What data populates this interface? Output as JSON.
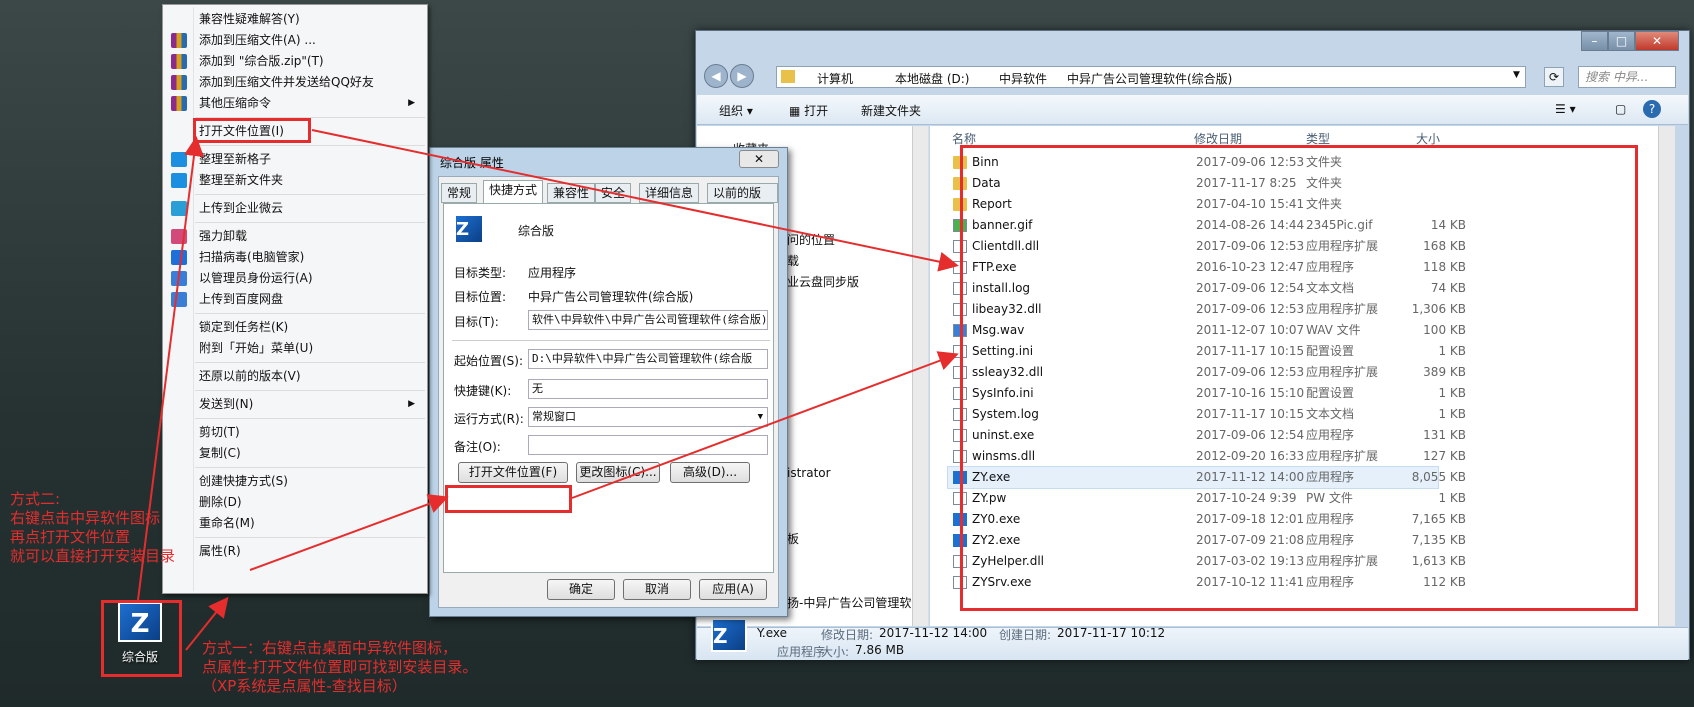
{
  "context_menu": {
    "items": [
      {
        "label": "兼容性疑难解答(Y)",
        "icon": ""
      },
      {
        "label": "添加到压缩文件(A) ...",
        "icon": "winrar-icon"
      },
      {
        "label": "添加到 \"综合版.zip\"(T)",
        "icon": "winrar-icon"
      },
      {
        "label": "添加到压缩文件并发送给QQ好友",
        "icon": "winrar-icon"
      },
      {
        "label": "其他压缩命令",
        "icon": "winrar-icon",
        "submenu": true
      },
      {
        "label": "打开文件位置(I)",
        "icon": ""
      },
      {
        "label": "整理至新格子",
        "icon": "plus-icon"
      },
      {
        "label": "整理至新文件夹",
        "icon": "plus-icon"
      },
      {
        "label": "上传到企业微云",
        "icon": "cloud-icon"
      },
      {
        "label": "强力卸载",
        "icon": "uninstall-icon"
      },
      {
        "label": "扫描病毒(电脑管家)",
        "icon": "shield-icon"
      },
      {
        "label": "以管理员身份运行(A)",
        "icon": "uac-shield-icon"
      },
      {
        "label": "上传到百度网盘",
        "icon": "baidu-icon"
      },
      {
        "label": "锁定到任务栏(K)",
        "icon": ""
      },
      {
        "label": "附到「开始」菜单(U)",
        "icon": ""
      },
      {
        "label": "还原以前的版本(V)",
        "icon": ""
      },
      {
        "label": "发送到(N)",
        "icon": "",
        "submenu": true
      },
      {
        "label": "剪切(T)",
        "icon": ""
      },
      {
        "label": "复制(C)",
        "icon": ""
      },
      {
        "label": "创建快捷方式(S)",
        "icon": ""
      },
      {
        "label": "删除(D)",
        "icon": ""
      },
      {
        "label": "重命名(M)",
        "icon": ""
      },
      {
        "label": "属性(R)",
        "icon": ""
      }
    ]
  },
  "annotations": {
    "method2": [
      "方式二:",
      "右键点击中异软件图标",
      "再点打开文件位置",
      "就可以直接打开安装目录"
    ],
    "method1": [
      "方式一：右键点击桌面中异软件图标，",
      "点属性-打开文件位置即可找到安装目录。",
      "（XP系统是点属性-查找目标）"
    ]
  },
  "desktop_icon": {
    "label": "综合版"
  },
  "dialog": {
    "title": "综合版 属性",
    "tabs": [
      "常规",
      "快捷方式",
      "兼容性",
      "安全",
      "详细信息",
      "以前的版本"
    ],
    "name": "综合版",
    "target_type_label": "目标类型:",
    "target_type": "应用程序",
    "target_location_label": "目标位置:",
    "target_location": "中异广告公司管理软件(综合版)",
    "target_label": "目标(T):",
    "target": "软件\\中异软件\\中异广告公司管理软件(综合版)\\ZY.exe",
    "start_in_label": "起始位置(S):",
    "start_in": "D:\\中异软件\\中异广告公司管理软件(综合版",
    "hotkey_label": "快捷键(K):",
    "hotkey": "无",
    "run_label": "运行方式(R):",
    "run": "常规窗口",
    "comment_label": "备注(O):",
    "comment": "",
    "btn_open_location": "打开文件位置(F)",
    "btn_change_icon": "更改图标(C)...",
    "btn_advanced": "高级(D)...",
    "btn_ok": "确定",
    "btn_cancel": "取消",
    "btn_apply": "应用(A)"
  },
  "explorer": {
    "breadcrumb": [
      "计算机",
      "本地磁盘 (D:)",
      "中异软件",
      "中异广告公司管理软件(综合版)"
    ],
    "search_placeholder": "搜索 中异...",
    "toolbar": {
      "organize": "组织 ▾",
      "open": "打开",
      "new_folder": "新建文件夹"
    },
    "nav_fragments": [
      "收藏夹",
      "问的位置",
      "载",
      "业云盘同步版",
      "istrator",
      "板",
      "扬-中异广告公司管理软件"
    ],
    "columns": [
      "名称",
      "修改日期",
      "类型",
      "大小"
    ],
    "files": [
      {
        "name": "Binn",
        "date": "2017-09-06 12:53",
        "type": "文件夹",
        "size": "",
        "kind": "folder"
      },
      {
        "name": "Data",
        "date": "2017-11-17 8:25",
        "type": "文件夹",
        "size": "",
        "kind": "folder"
      },
      {
        "name": "Report",
        "date": "2017-04-10 15:41",
        "type": "文件夹",
        "size": "",
        "kind": "folder"
      },
      {
        "name": "banner.gif",
        "date": "2014-08-26 14:44",
        "type": "2345Pic.gif",
        "size": "14 KB",
        "kind": "image"
      },
      {
        "name": "Clientdll.dll",
        "date": "2017-09-06 12:53",
        "type": "应用程序扩展",
        "size": "168 KB",
        "kind": "generic"
      },
      {
        "name": "FTP.exe",
        "date": "2016-10-23 12:47",
        "type": "应用程序",
        "size": "118 KB",
        "kind": "generic"
      },
      {
        "name": "install.log",
        "date": "2017-09-06 12:54",
        "type": "文本文档",
        "size": "74 KB",
        "kind": "generic"
      },
      {
        "name": "libeay32.dll",
        "date": "2017-09-06 12:53",
        "type": "应用程序扩展",
        "size": "1,306 KB",
        "kind": "generic"
      },
      {
        "name": "Msg.wav",
        "date": "2011-12-07 10:07",
        "type": "WAV 文件",
        "size": "100 KB",
        "kind": "audio"
      },
      {
        "name": "Setting.ini",
        "date": "2017-11-17 10:15",
        "type": "配置设置",
        "size": "1 KB",
        "kind": "generic"
      },
      {
        "name": "ssleay32.dll",
        "date": "2017-09-06 12:53",
        "type": "应用程序扩展",
        "size": "389 KB",
        "kind": "generic"
      },
      {
        "name": "SysInfo.ini",
        "date": "2017-10-16 15:10",
        "type": "配置设置",
        "size": "1 KB",
        "kind": "generic"
      },
      {
        "name": "System.log",
        "date": "2017-11-17 10:15",
        "type": "文本文档",
        "size": "1 KB",
        "kind": "generic"
      },
      {
        "name": "uninst.exe",
        "date": "2017-09-06 12:54",
        "type": "应用程序",
        "size": "131 KB",
        "kind": "generic"
      },
      {
        "name": "winsms.dll",
        "date": "2012-09-20 16:33",
        "type": "应用程序扩展",
        "size": "127 KB",
        "kind": "generic"
      },
      {
        "name": "ZY.exe",
        "date": "2017-11-12 14:00",
        "type": "应用程序",
        "size": "8,055 KB",
        "kind": "zy",
        "selected": true
      },
      {
        "name": "ZY.pw",
        "date": "2017-10-24 9:39",
        "type": "PW 文件",
        "size": "1 KB",
        "kind": "generic"
      },
      {
        "name": "ZY0.exe",
        "date": "2017-09-18 12:01",
        "type": "应用程序",
        "size": "7,165 KB",
        "kind": "zy"
      },
      {
        "name": "ZY2.exe",
        "date": "2017-07-09 21:08",
        "type": "应用程序",
        "size": "7,135 KB",
        "kind": "zy"
      },
      {
        "name": "ZyHelper.dll",
        "date": "2017-03-02 19:13",
        "type": "应用程序扩展",
        "size": "1,613 KB",
        "kind": "generic"
      },
      {
        "name": "ZYSrv.exe",
        "date": "2017-10-12 11:41",
        "type": "应用程序",
        "size": "112 KB",
        "kind": "generic"
      }
    ],
    "details": {
      "name": "Y.exe",
      "modified_label": "修改日期:",
      "modified": "2017-11-12 14:00",
      "created_label": "创建日期:",
      "created": "2017-11-17 10:12",
      "type": "应用程序",
      "size_label": "大小:",
      "size": "7.86 MB"
    }
  }
}
